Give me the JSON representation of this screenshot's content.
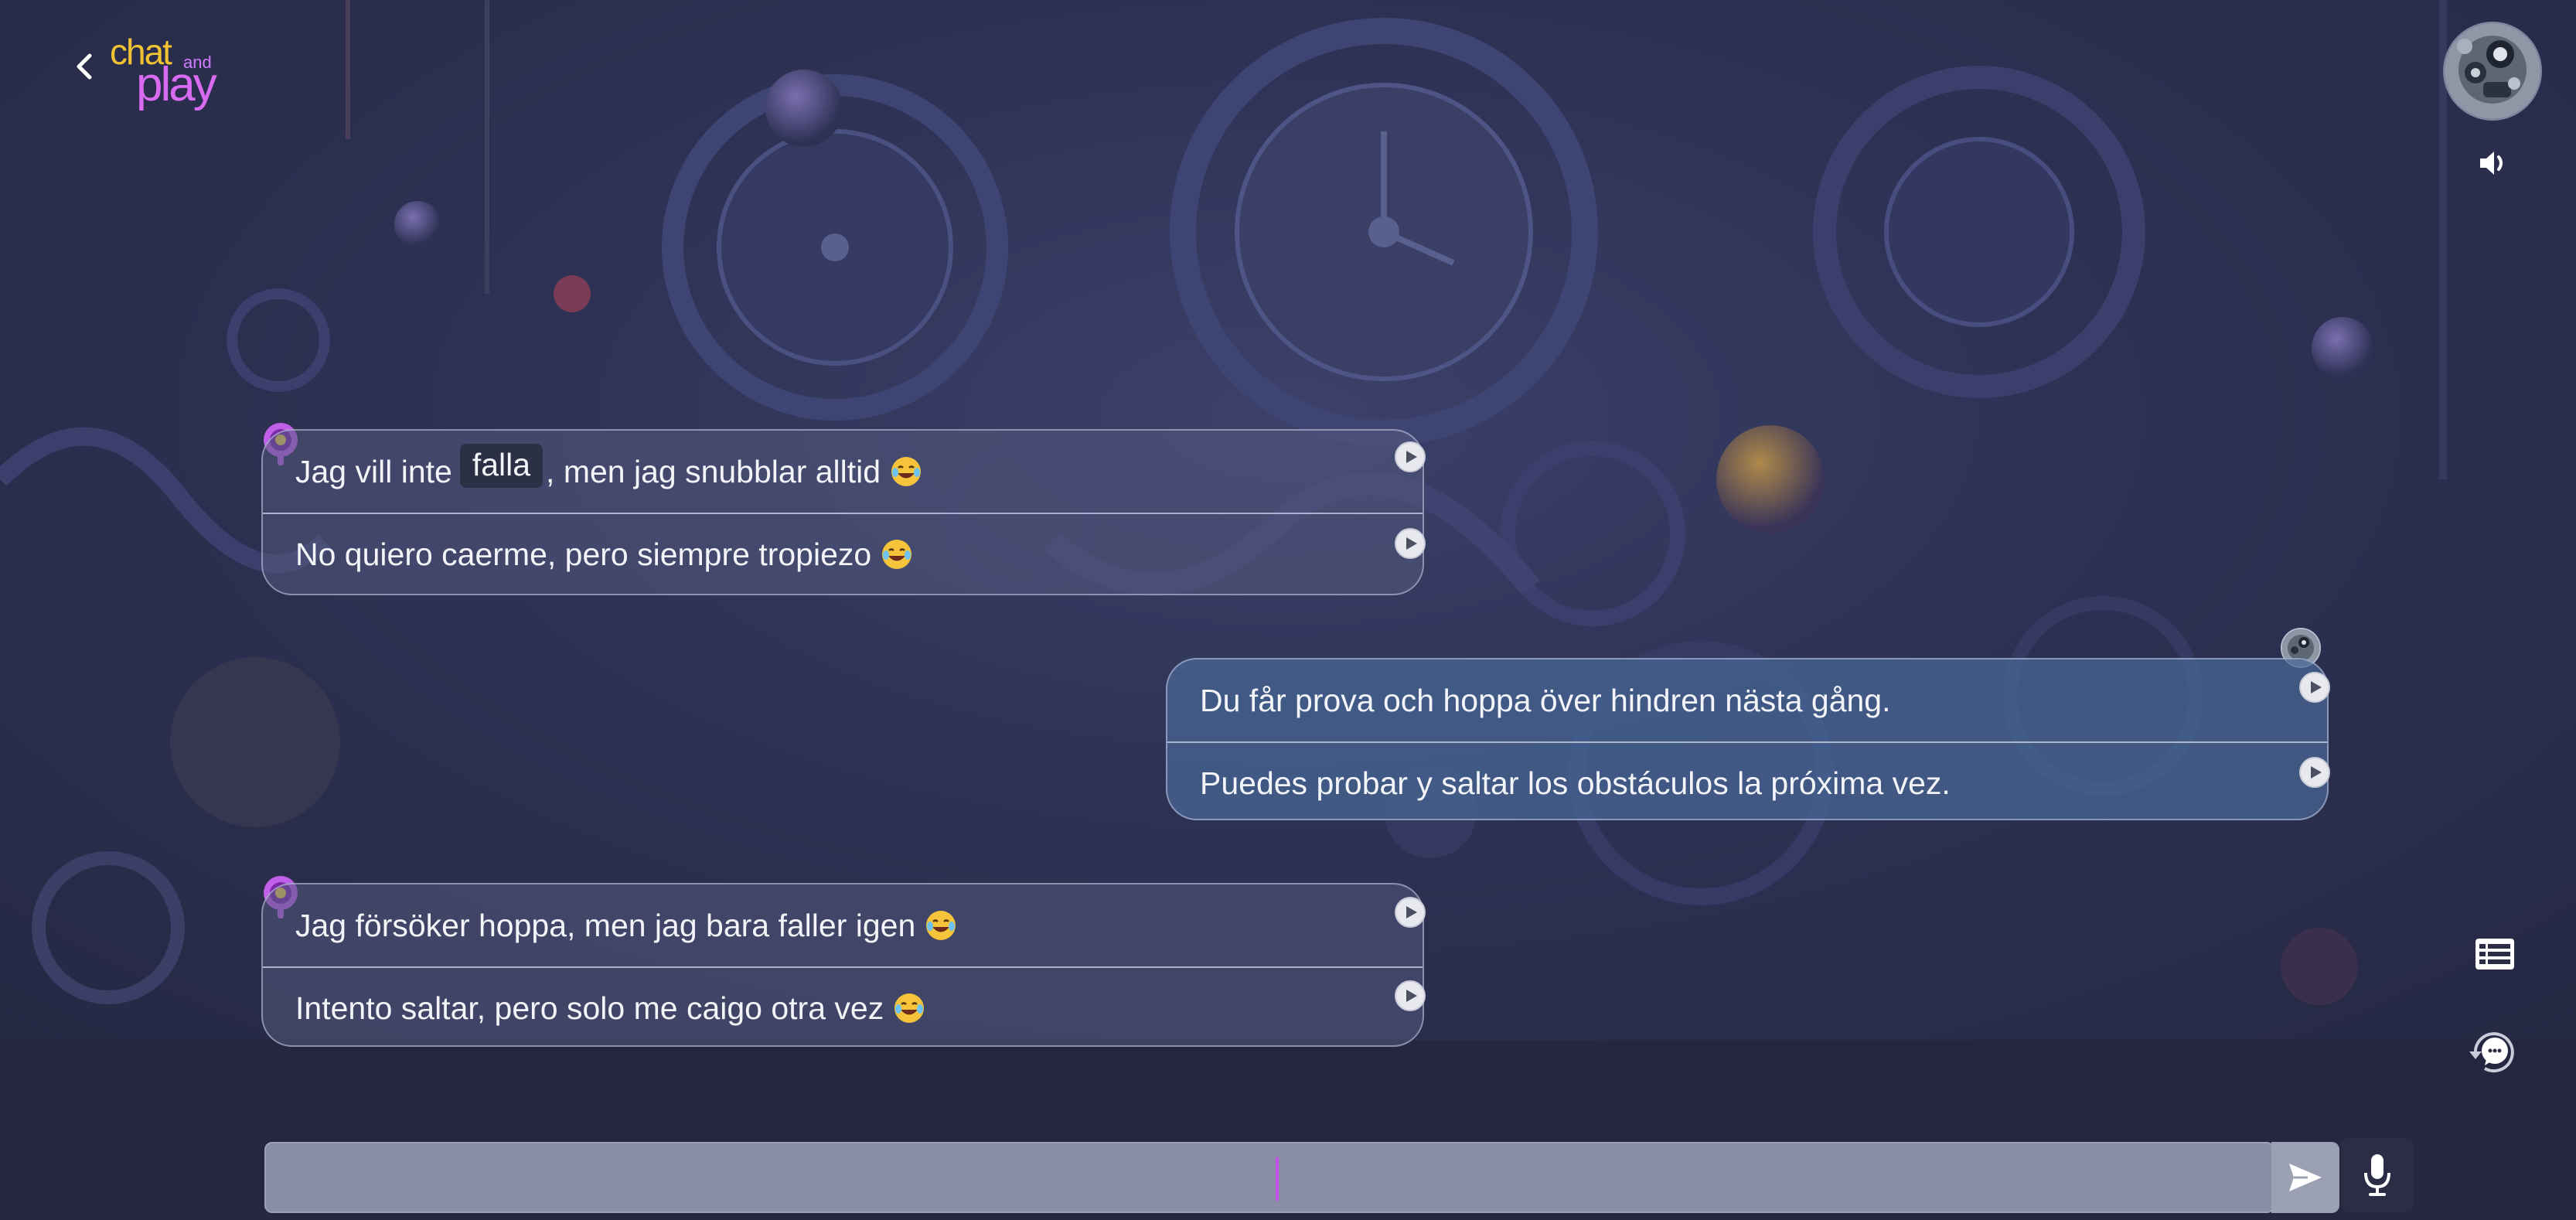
{
  "app": {
    "logo": {
      "chat": "chat",
      "and": "and",
      "play": "play"
    }
  },
  "header": {
    "back_icon": "chevron-left-icon",
    "profile_icon": "robot-avatar",
    "speaker_icon": "speaker-volume-icon"
  },
  "messages": [
    {
      "role": "bot",
      "original_before": "Jag vill inte",
      "highlight_word": "falla",
      "original_after": ", men jag snubblar alltid",
      "original_emoji": "laughing-tears-emoji",
      "translation": "No quiero caerme, pero siempre tropiezo",
      "translation_emoji": "laughing-tears-emoji"
    },
    {
      "role": "user",
      "original": "Du får prova och hoppa över hindren nästa gång.",
      "translation": "Puedes probar y saltar los obstáculos la próxima vez."
    },
    {
      "role": "bot",
      "original": "Jag försöker hoppa, men jag bara faller igen",
      "original_emoji": "laughing-tears-emoji",
      "translation": "Intento saltar, pero solo me caigo otra vez",
      "translation_emoji": "laughing-tears-emoji"
    }
  ],
  "side_tools": {
    "list_icon": "list-icon",
    "refresh_icon": "chat-refresh-icon"
  },
  "composer": {
    "input_value": "",
    "placeholder": "",
    "send_icon": "send-icon",
    "mic_icon": "microphone-icon"
  },
  "colors": {
    "background": "#22253c",
    "bot_bubble": "#54597d",
    "user_bubble": "#486896",
    "accent": "#c24fe8"
  }
}
